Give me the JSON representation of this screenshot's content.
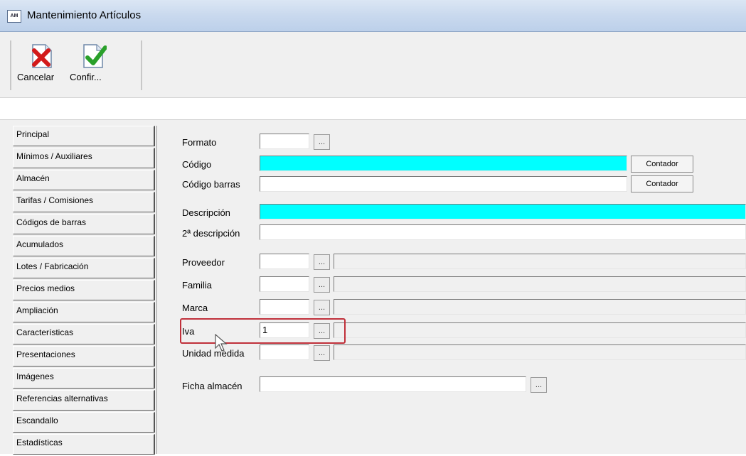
{
  "window": {
    "title": "Mantenimiento Artículos",
    "app_icon_text": "AM"
  },
  "toolbar": {
    "cancel_label": "Cancelar",
    "confirm_label": "Confir..."
  },
  "sidebar": {
    "items": [
      "Principal",
      "Mínimos / Auxiliares",
      "Almacén",
      "Tarifas / Comisiones",
      "Códigos de barras",
      "Acumulados",
      "Lotes / Fabricación",
      "Precios medios",
      "Ampliación",
      "Características",
      "Presentaciones",
      "Imágenes",
      "Referencias alternativas",
      "Escandallo",
      "Estadísticas"
    ]
  },
  "form": {
    "formato_label": "Formato",
    "codigo_label": "Código",
    "codigo_barras_label": "Código barras",
    "contador1_label": "Contador",
    "contador2_label": "Contador",
    "descripcion_label": "Descripción",
    "descripcion2_label": "2ª descripción",
    "proveedor_label": "Proveedor",
    "familia_label": "Familia",
    "marca_label": "Marca",
    "iva_label": "Iva",
    "iva_value": "1",
    "unidad_medida_label": "Unidad medida",
    "ficha_almacen_label": "Ficha almacén",
    "browse_label": "..."
  },
  "colors": {
    "required_field": "#00ffff",
    "highlight": "#c0303a"
  }
}
